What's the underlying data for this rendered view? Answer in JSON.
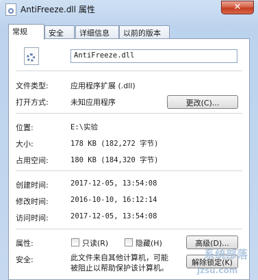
{
  "window": {
    "title": "AntiFreeze.dll 属性",
    "close_glyph": "✕"
  },
  "tabs": [
    {
      "label": "常规"
    },
    {
      "label": "安全"
    },
    {
      "label": "详细信息"
    },
    {
      "label": "以前的版本"
    }
  ],
  "general": {
    "filename": "AntiFreeze.dll",
    "file_type_label": "文件类型:",
    "file_type_value": "应用程序扩展 (.dll)",
    "opens_with_label": "打开方式:",
    "opens_with_value": "未知应用程序",
    "change_button": "更改(C)...",
    "location_label": "位置:",
    "location_value": "E:\\实验",
    "size_label": "大小:",
    "size_value": "178 KB (182,272 字节)",
    "size_on_disk_label": "占用空间:",
    "size_on_disk_value": "180 KB (184,320 字节)",
    "created_label": "创建时间:",
    "created_value": "2017-12-05, 13:54:08",
    "modified_label": "修改时间:",
    "modified_value": "2016-10-10, 16:12:14",
    "accessed_label": "访问时间:",
    "accessed_value": "2017-12-05, 13:54:08",
    "attributes_label": "属性:",
    "readonly_label": "只读(R)",
    "hidden_label": "隐藏(H)",
    "advanced_button": "高级(D)...",
    "security_label": "安全:",
    "security_text_line1": "此文件来自其他计算机，可能",
    "security_text_line2": "被阻止以帮助保护该计算机。",
    "unblock_button": "解除锁定(K)"
  },
  "watermark": {
    "line1": "系统部落",
    "line2": "jzsu.com"
  }
}
